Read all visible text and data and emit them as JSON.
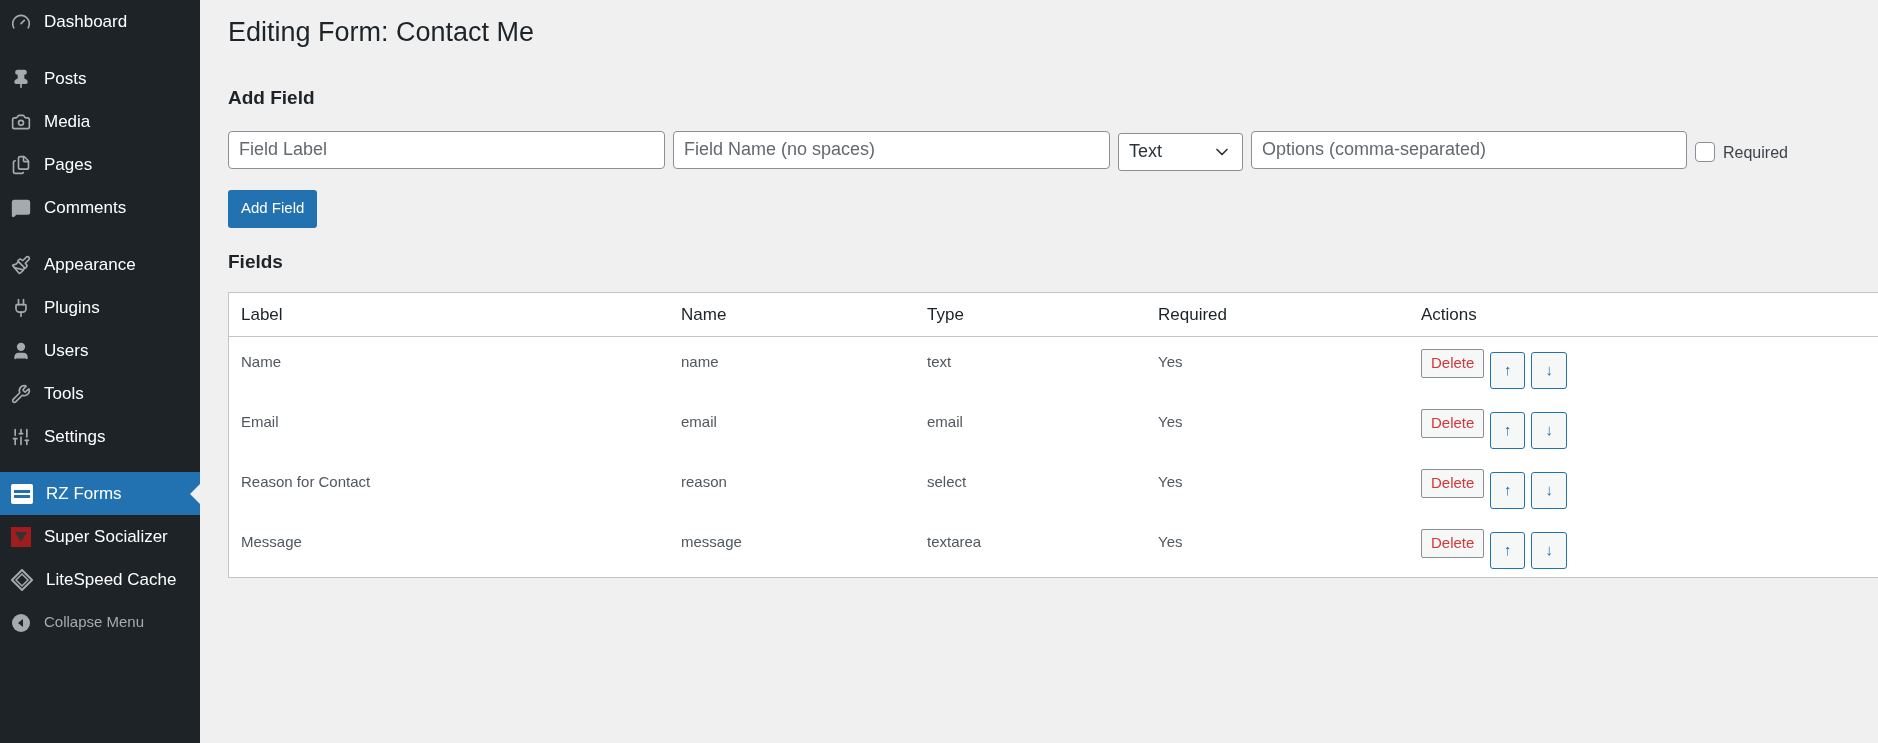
{
  "sidebar": {
    "items": [
      {
        "label": "Dashboard",
        "selected": false,
        "kind": "item"
      },
      {
        "label": "Posts",
        "selected": false,
        "kind": "item"
      },
      {
        "label": "Media",
        "selected": false,
        "kind": "item"
      },
      {
        "label": "Pages",
        "selected": false,
        "kind": "item"
      },
      {
        "label": "Comments",
        "selected": false,
        "kind": "item"
      },
      {
        "label": "Appearance",
        "selected": false,
        "kind": "item"
      },
      {
        "label": "Plugins",
        "selected": false,
        "kind": "item"
      },
      {
        "label": "Users",
        "selected": false,
        "kind": "item"
      },
      {
        "label": "Tools",
        "selected": false,
        "kind": "item"
      },
      {
        "label": "Settings",
        "selected": false,
        "kind": "item"
      },
      {
        "label": "RZ Forms",
        "selected": true,
        "kind": "item"
      },
      {
        "label": "Super Socializer",
        "selected": false,
        "kind": "item"
      },
      {
        "label": "LiteSpeed Cache",
        "selected": false,
        "kind": "item"
      },
      {
        "label": "Collapse Menu",
        "selected": false,
        "kind": "collapse"
      }
    ]
  },
  "title": "Editing Form: Contact Me",
  "add_field": {
    "heading": "Add Field",
    "label_field": {
      "placeholder": "Field Label"
    },
    "name_field": {
      "placeholder": "Field Name (no spaces)"
    },
    "type_select": {
      "value": "Text"
    },
    "options_field": {
      "placeholder": "Options (comma-separated)"
    },
    "required": {
      "label": "Required",
      "checked": false
    },
    "button": "Add Field"
  },
  "fields": {
    "heading": "Fields",
    "table": {
      "columns": [
        "Label",
        "Name",
        "Type",
        "Required",
        "Actions"
      ],
      "rows": [
        {
          "label": "Name",
          "name": "name",
          "type": "text",
          "required": "Yes",
          "delete": "Delete",
          "up": "↑",
          "down": "↓"
        },
        {
          "label": "Email",
          "name": "email",
          "type": "email",
          "required": "Yes",
          "delete": "Delete",
          "up": "↑",
          "down": "↓"
        },
        {
          "label": "Reason for Contact",
          "name": "reason",
          "type": "select",
          "required": "Yes",
          "delete": "Delete",
          "up": "↑",
          "down": "↓"
        },
        {
          "label": "Message",
          "name": "message",
          "type": "textarea",
          "required": "Yes",
          "delete": "Delete",
          "up": "↑",
          "down": "↓"
        }
      ]
    }
  }
}
